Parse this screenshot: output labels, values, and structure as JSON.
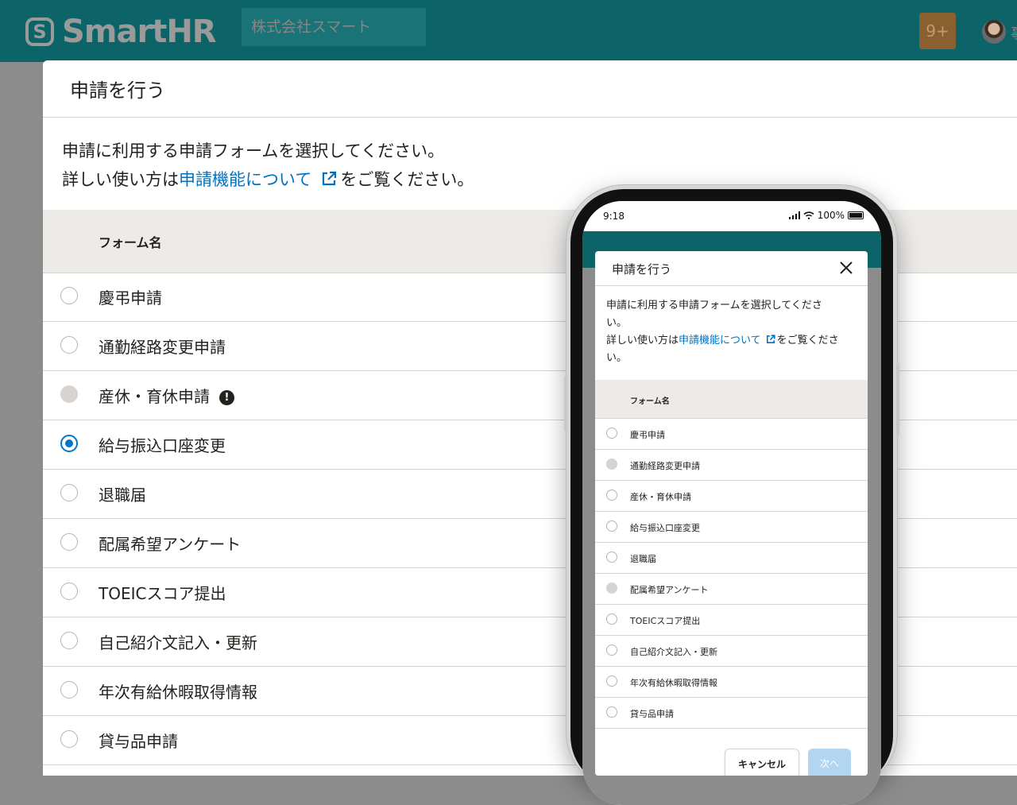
{
  "header": {
    "logo_mark": "S",
    "logo_text": "SmartHR",
    "tenant": "株式会社スマート",
    "notification_count": "9+",
    "user_initial": "事"
  },
  "modal": {
    "title": "申請を行う",
    "intro_line1": "申請に利用する申請フォームを選択してください。",
    "intro_line2_prefix": "詳しい使い方は",
    "intro_link": "申請機能について",
    "intro_line2_suffix": "をご覧ください。",
    "column_header": "フォーム名",
    "rows": [
      {
        "label": "慶弔申請",
        "state": "unchecked"
      },
      {
        "label": "通勤経路変更申請",
        "state": "unchecked"
      },
      {
        "label": "産休・育休申請",
        "state": "disabled",
        "warning": "!"
      },
      {
        "label": "給与振込口座変更",
        "state": "checked"
      },
      {
        "label": "退職届",
        "state": "unchecked"
      },
      {
        "label": "配属希望アンケート",
        "state": "unchecked"
      },
      {
        "label": "TOEICスコア提出",
        "state": "unchecked"
      },
      {
        "label": "自己紹介文記入・更新",
        "state": "unchecked"
      },
      {
        "label": "年次有給休暇取得情報",
        "state": "unchecked"
      },
      {
        "label": "貸与品申請",
        "state": "unchecked"
      }
    ]
  },
  "phone": {
    "time": "9:18",
    "battery": "100%",
    "modal": {
      "title": "申請を行う",
      "intro_line1": "申請に利用する申請フォームを選択してくださ",
      "intro_line1b": "い。",
      "intro_line2_prefix": "詳しい使い方は",
      "intro_link": "申請機能について",
      "intro_line2_suffix": "をご覧くださ",
      "intro_line2b": "い。",
      "column_header": "フォーム名",
      "rows": [
        {
          "label": "慶弔申請",
          "state": "unchecked"
        },
        {
          "label": "通勤経路変更申請",
          "state": "disabled"
        },
        {
          "label": "産休・育休申請",
          "state": "unchecked"
        },
        {
          "label": "給与振込口座変更",
          "state": "unchecked"
        },
        {
          "label": "退職届",
          "state": "unchecked"
        },
        {
          "label": "配属希望アンケート",
          "state": "disabled"
        },
        {
          "label": "TOEICスコア提出",
          "state": "unchecked"
        },
        {
          "label": "自己紹介文記入・更新",
          "state": "unchecked"
        },
        {
          "label": "年次有給休暇取得情報",
          "state": "unchecked"
        },
        {
          "label": "貸与品申請",
          "state": "unchecked"
        }
      ],
      "cancel_label": "キャンセル",
      "next_label": "次へ"
    }
  },
  "colors": {
    "header_bg": "#0d6468",
    "link": "#0071c1",
    "radio_checked": "#0077c7",
    "next_disabled": "#b2d6ef"
  }
}
